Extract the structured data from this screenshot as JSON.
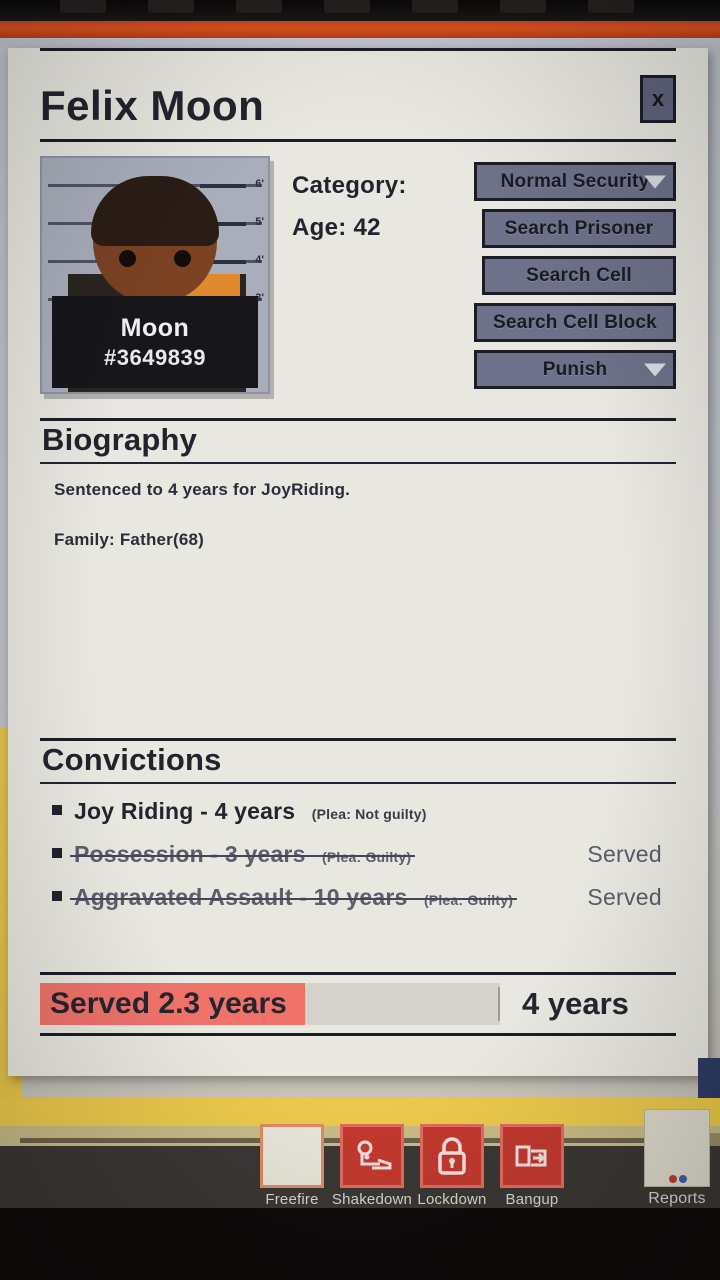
{
  "window": {
    "title": "Felix Moon",
    "close_label": "x"
  },
  "mugshot": {
    "name": "Moon",
    "id": "#3649839",
    "ruler_labels": [
      "6'",
      "5'",
      "4'",
      "3'"
    ]
  },
  "stats": {
    "category_label": "Category:",
    "category_value": "",
    "age_label": "Age:",
    "age_value": "42"
  },
  "actions": [
    {
      "label": "Normal Security",
      "type": "dropdown"
    },
    {
      "label": "Search Prisoner",
      "type": "button"
    },
    {
      "label": "Search Cell",
      "type": "button"
    },
    {
      "label": "Search Cell Block",
      "type": "button"
    },
    {
      "label": "Punish",
      "type": "dropdown"
    }
  ],
  "biography": {
    "heading": "Biography",
    "lines": [
      "Sentenced to 4 years for JoyRiding.",
      "Family: Father(68)"
    ]
  },
  "convictions": {
    "heading": "Convictions",
    "served_label": "Served",
    "items": [
      {
        "crime": "Joy Riding - 4 years",
        "plea": "(Plea: Not guilty)",
        "served": false
      },
      {
        "crime": "Possession - 3 years",
        "plea": "(Plea: Guilty)",
        "served": true
      },
      {
        "crime": "Aggravated Assault - 10 years",
        "plea": "(Plea: Guilty)",
        "served": true
      }
    ]
  },
  "sentence": {
    "served_text": "Served 2.3 years",
    "total_text": "4 years",
    "served_years": 2.3,
    "total_years": 4,
    "fill_percent": 57.5,
    "fill_color": "#f0736a"
  },
  "taskbar": {
    "items": [
      {
        "label": "Freefire",
        "icon": "blank-icon",
        "glyph": ""
      },
      {
        "label": "Shakedown",
        "icon": "shakedown-icon",
        "glyph": "⛏"
      },
      {
        "label": "Lockdown",
        "icon": "padlock-icon",
        "glyph": "ὑ2"
      },
      {
        "label": "Bangup",
        "icon": "bed-icon",
        "glyph": "☰"
      }
    ],
    "reports_label": "Reports"
  }
}
